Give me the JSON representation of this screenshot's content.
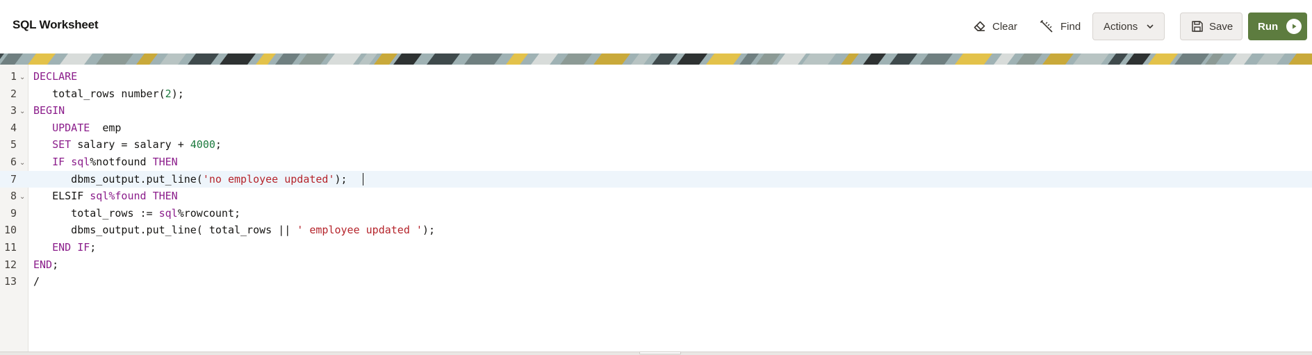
{
  "header": {
    "title": "SQL Worksheet",
    "clear_label": "Clear",
    "find_label": "Find",
    "actions_label": "Actions",
    "save_label": "Save",
    "run_label": "Run",
    "run_color": "#5d7c3f"
  },
  "icons": {
    "clear": "eraser-icon",
    "find": "magic-wand-icon",
    "actions": "chevron-down-icon",
    "save": "floppy-disk-icon",
    "run": "play-icon",
    "fold": "fold-arrow-icon"
  },
  "editor": {
    "active_line": 7,
    "lines": [
      {
        "n": "1",
        "fold": true,
        "tokens": [
          {
            "t": "DECLARE",
            "k": "kw"
          }
        ]
      },
      {
        "n": "2",
        "fold": false,
        "tokens": [
          {
            "t": "   total_rows number(",
            "k": "p"
          },
          {
            "t": "2",
            "k": "num"
          },
          {
            "t": ");",
            "k": "p"
          }
        ]
      },
      {
        "n": "3",
        "fold": true,
        "tokens": [
          {
            "t": "BEGIN",
            "k": "kw"
          }
        ]
      },
      {
        "n": "4",
        "fold": false,
        "tokens": [
          {
            "t": "   ",
            "k": "p"
          },
          {
            "t": "UPDATE",
            "k": "kw"
          },
          {
            "t": "  emp",
            "k": "p"
          }
        ]
      },
      {
        "n": "5",
        "fold": false,
        "tokens": [
          {
            "t": "   ",
            "k": "p"
          },
          {
            "t": "SET",
            "k": "kw"
          },
          {
            "t": " salary = salary + ",
            "k": "p"
          },
          {
            "t": "4000",
            "k": "num"
          },
          {
            "t": ";",
            "k": "p"
          }
        ]
      },
      {
        "n": "6",
        "fold": true,
        "tokens": [
          {
            "t": "   ",
            "k": "p"
          },
          {
            "t": "IF",
            "k": "kw"
          },
          {
            "t": " ",
            "k": "p"
          },
          {
            "t": "sql",
            "k": "kw"
          },
          {
            "t": "%notfound ",
            "k": "p"
          },
          {
            "t": "THEN",
            "k": "kw"
          }
        ]
      },
      {
        "n": "7",
        "fold": false,
        "tokens": [
          {
            "t": "      dbms_output.put_line(",
            "k": "p"
          },
          {
            "t": "'no employee updated'",
            "k": "str"
          },
          {
            "t": ");",
            "k": "p"
          }
        ],
        "caret": true
      },
      {
        "n": "8",
        "fold": true,
        "tokens": [
          {
            "t": "   ELSIF ",
            "k": "p"
          },
          {
            "t": "sql",
            "k": "kw"
          },
          {
            "t": "%found ",
            "k": "kw"
          },
          {
            "t": "THEN",
            "k": "kw"
          }
        ]
      },
      {
        "n": "9",
        "fold": false,
        "tokens": [
          {
            "t": "      total_rows := ",
            "k": "p"
          },
          {
            "t": "sql",
            "k": "kw"
          },
          {
            "t": "%rowcount;",
            "k": "p"
          }
        ]
      },
      {
        "n": "10",
        "fold": false,
        "tokens": [
          {
            "t": "      dbms_output.put_line( total_rows || ",
            "k": "p"
          },
          {
            "t": "' employee updated '",
            "k": "str"
          },
          {
            "t": ");",
            "k": "p"
          }
        ]
      },
      {
        "n": "11",
        "fold": false,
        "tokens": [
          {
            "t": "   ",
            "k": "p"
          },
          {
            "t": "END",
            "k": "kw"
          },
          {
            "t": " ",
            "k": "p"
          },
          {
            "t": "IF",
            "k": "kw"
          },
          {
            "t": ";",
            "k": "p"
          }
        ]
      },
      {
        "n": "12",
        "fold": false,
        "tokens": [
          {
            "t": "END",
            "k": "kw"
          },
          {
            "t": ";",
            "k": "p"
          }
        ]
      },
      {
        "n": "13",
        "fold": false,
        "tokens": [
          {
            "t": "/",
            "k": "p"
          }
        ]
      }
    ]
  }
}
